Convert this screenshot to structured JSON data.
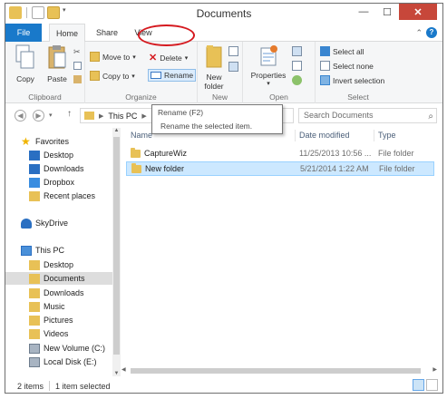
{
  "window": {
    "title": "Documents"
  },
  "tabs": {
    "file": "File",
    "home": "Home",
    "share": "Share",
    "view": "View"
  },
  "ribbon": {
    "clipboard": {
      "label": "Clipboard",
      "copy": "Copy",
      "paste": "Paste"
    },
    "organize": {
      "label": "Organize",
      "move_to": "Move to",
      "copy_to": "Copy to",
      "delete": "Delete",
      "rename": "Rename"
    },
    "new": {
      "label": "New",
      "new_folder_line1": "New",
      "new_folder_line2": "folder"
    },
    "open": {
      "label": "Open",
      "properties": "Properties"
    },
    "select": {
      "label": "Select",
      "select_all": "Select all",
      "select_none": "Select none",
      "invert": "Invert selection"
    }
  },
  "address": {
    "path": "This PC",
    "search_placeholder": "Search Documents"
  },
  "tooltip": {
    "title": "Rename (F2)",
    "description": "Rename the selected item."
  },
  "navpane": {
    "favorites": "Favorites",
    "desktop": "Desktop",
    "downloads": "Downloads",
    "dropbox": "Dropbox",
    "recent": "Recent places",
    "skydrive": "SkyDrive",
    "thispc": "This PC",
    "pc_desktop": "Desktop",
    "documents": "Documents",
    "pc_downloads": "Downloads",
    "music": "Music",
    "pictures": "Pictures",
    "videos": "Videos",
    "new_volume": "New Volume (C:)",
    "local_disk": "Local Disk (E:)"
  },
  "columns": {
    "name": "Name",
    "date": "Date modified",
    "type": "Type"
  },
  "files": [
    {
      "name": "CaptureWiz",
      "date": "11/25/2013 10:56 ...",
      "type": "File folder"
    },
    {
      "name": "New folder",
      "date": "5/21/2014 1:22 AM",
      "type": "File folder"
    }
  ],
  "status": {
    "count": "2 items",
    "selected": "1 item selected"
  },
  "colors": {
    "accent": "#1979ca",
    "highlight_oval": "#d5191f",
    "selection": "#cce8ff"
  }
}
